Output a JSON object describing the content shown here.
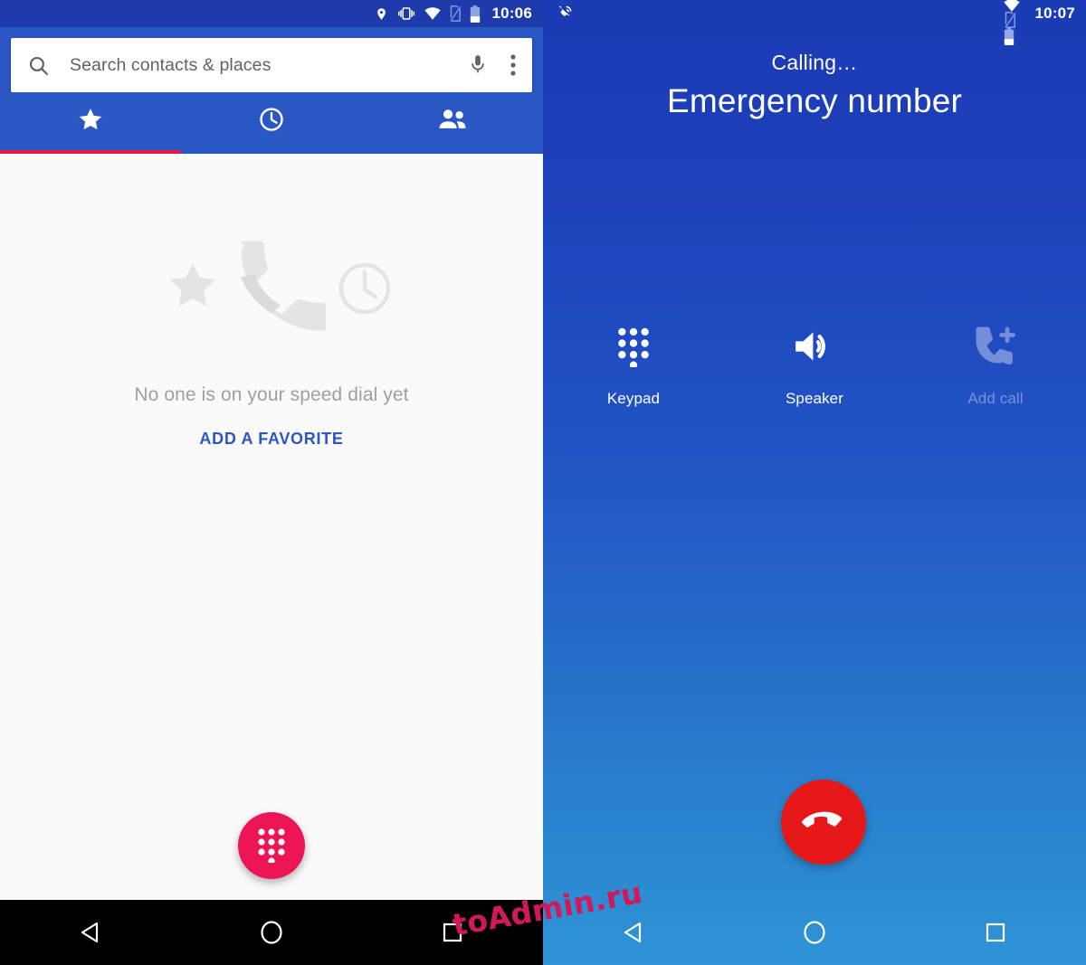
{
  "left_phone": {
    "status_bar": {
      "time": "10:06",
      "icons": [
        "location-pin-icon",
        "vibrate-icon",
        "wifi-icon",
        "no-sim-icon",
        "battery-icon"
      ]
    },
    "search": {
      "placeholder": "Search contacts & places",
      "value": "",
      "search_icon": "search-icon",
      "mic_icon": "microphone-icon",
      "overflow_icon": "more-vert-icon"
    },
    "tabs": [
      {
        "label": "Favorites",
        "icon": "star-icon",
        "active": true
      },
      {
        "label": "Recents",
        "icon": "clock-icon",
        "active": false
      },
      {
        "label": "Contacts",
        "icon": "people-icon",
        "active": false
      }
    ],
    "empty_state": {
      "message": "No one is on your speed dial yet",
      "action_label": "ADD A FAVORITE",
      "illustration": "star-phone-clock-illustration"
    },
    "fab": {
      "icon": "dialpad-icon",
      "label": "Dialpad",
      "color": "#ec1556"
    },
    "nav_bar": {
      "back": "back-triangle-icon",
      "home": "home-circle-icon",
      "recents": "recents-square-icon",
      "background": "#000000"
    },
    "colors": {
      "header": "#2b57c4",
      "status_bar": "#1e3bac",
      "body": "#fafafa",
      "tab_indicator": "#e8154a",
      "link": "#2a56c6"
    }
  },
  "right_phone": {
    "status_bar": {
      "time": "10:07",
      "call_icon": "ongoing-call-icon",
      "icons": [
        "vibrate-icon",
        "wifi-icon",
        "no-sim-icon",
        "battery-icon"
      ]
    },
    "call": {
      "status": "Calling…",
      "name": "Emergency number"
    },
    "controls": [
      {
        "label": "Keypad",
        "icon": "dialpad-icon",
        "disabled": false
      },
      {
        "label": "Speaker",
        "icon": "speaker-icon",
        "disabled": false
      },
      {
        "label": "Add call",
        "icon": "add-call-icon",
        "disabled": true
      }
    ],
    "end_call": {
      "icon": "call-end-icon",
      "label": "End call",
      "color": "#e61717"
    },
    "nav_bar": {
      "back": "back-triangle-icon",
      "home": "home-circle-icon",
      "recents": "recents-square-icon"
    },
    "colors": {
      "gradient_top": "#1c3cb6",
      "gradient_bottom": "#2f93d6"
    }
  },
  "watermark": {
    "text": "toAdmin.ru",
    "color": "#d2185a"
  }
}
